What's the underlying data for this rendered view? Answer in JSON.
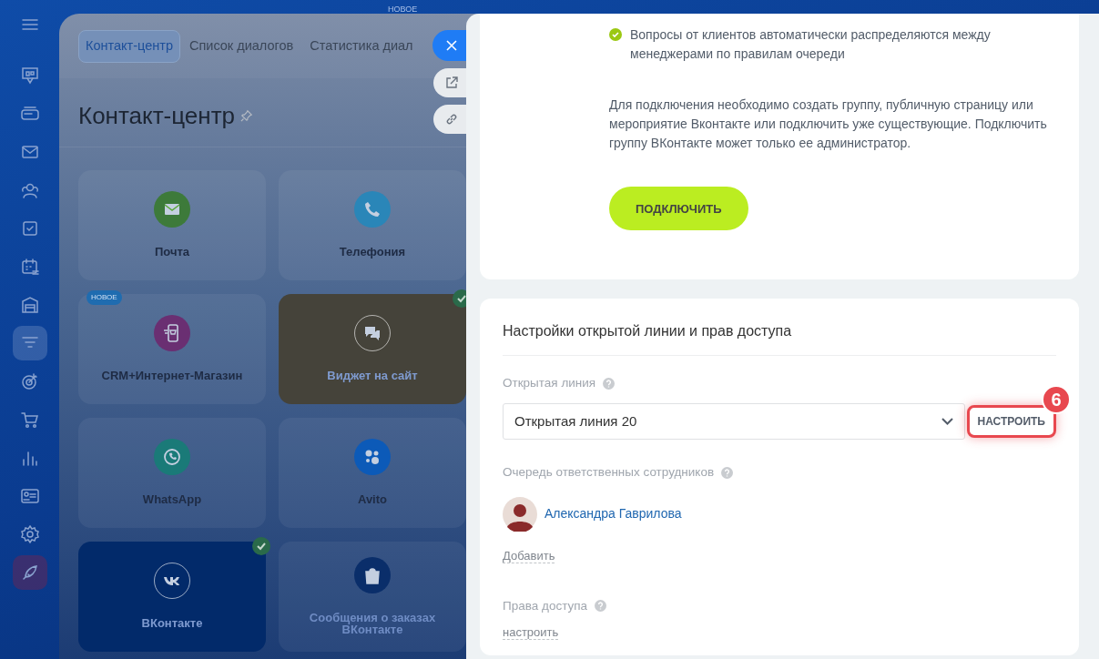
{
  "sidebar": {
    "items": [
      {
        "selected": false
      },
      {
        "selected": false
      },
      {
        "selected": false
      },
      {
        "selected": false
      },
      {
        "selected": false
      },
      {
        "selected": false
      },
      {
        "selected": false
      },
      {
        "selected": false
      },
      {
        "selected": true
      },
      {
        "selected": false
      },
      {
        "selected": false
      },
      {
        "selected": false
      },
      {
        "selected": false
      },
      {
        "selected": false
      },
      {
        "selected": false
      }
    ]
  },
  "background_badge": "НОВОЕ",
  "contact_center": {
    "tabs": [
      {
        "label": "Контакт-центр",
        "selected": true
      },
      {
        "label": "Список диалогов",
        "selected": false
      },
      {
        "label": "Статистика диал",
        "selected": false
      }
    ],
    "title": "Контакт-центр",
    "cards": [
      {
        "title": "Почта",
        "color": "#3d7a3a",
        "connected": false
      },
      {
        "title": "Телефония",
        "color": "#2a86b8",
        "connected": false
      },
      {
        "title": "CRM+Интернет-Магазин",
        "color": "#6a2f72",
        "connected": false,
        "badge": "НОВОЕ"
      },
      {
        "title": "Виджет на сайт",
        "color": "#45433a",
        "connected": true
      },
      {
        "title": "WhatsApp",
        "color": "#1a7a78",
        "connected": false
      },
      {
        "title": "Avito",
        "color": "#0c5ab8",
        "connected": false
      },
      {
        "title": "ВКонтакте",
        "color": "#022a6a",
        "connected": true
      },
      {
        "title": "Сообщения о заказах ВКонтакте",
        "color": "#0a2e6a",
        "connected": false
      }
    ]
  },
  "vk_panel": {
    "features": [
      {
        "text": "Вопросы от клиентов автоматически распределяются между менеджерами по правилам очереди",
        "checked": true
      }
    ],
    "note": "Для подключения необходимо создать группу, публичную страницу или мероприятие Вконтакте или подключить уже существующие. Подключить группу ВКонтакте может только ее администратор.",
    "connect_button": "ПОДКЛЮЧИТЬ"
  },
  "settings": {
    "title": "Настройки открытой линии и прав доступа",
    "open_line": {
      "label": "Открытая линия",
      "value": "Открытая линия 20",
      "configure_button": "НАСТРОИТЬ",
      "highlighted": true,
      "step_badge": "6"
    },
    "queue": {
      "label": "Очередь ответственных сотрудников",
      "members": [
        {
          "name": "Александра Гаврилова"
        }
      ],
      "add_link": "Добавить"
    },
    "access": {
      "label": "Права доступа",
      "configure_link": "настроить"
    }
  }
}
